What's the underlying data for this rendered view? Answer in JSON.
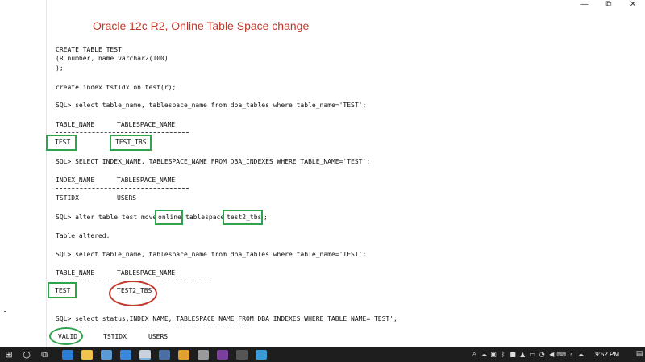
{
  "window": {
    "min_icon": "minimize-icon",
    "max_icon": "restore-icon",
    "close_icon": "close-icon",
    "min_glyph": "—",
    "max_glyph": "⧉",
    "close_glyph": "✕"
  },
  "document": {
    "title": "Oracle 12c R2, Online Table Space change",
    "lines": {
      "create_table": "CREATE TABLE TEST",
      "columns": "(R number, name varchar2(100)",
      "close_paren": ");",
      "create_index": "create index tstidx on test(r);",
      "query1": "SQL> select table_name, tablespace_name from dba_tables where table_name='TEST';",
      "header1_col1": "TABLE_NAME",
      "header1_col2": "TABLESPACE_NAME",
      "row1_col1": "TEST",
      "row1_col2": "TEST_TBS",
      "query2": "SQL> SELECT INDEX_NAME, TABLESPACE_NAME FROM DBA_INDEXES WHERE TABLE_NAME='TEST';",
      "header2_col1": "INDEX_NAME",
      "header2_col2": "TABLESPACE_NAME",
      "row2_col1": "TSTIDX",
      "row2_col2": "USERS",
      "alter_prefix": "SQL> alter table test move",
      "alter_online": "online",
      "alter_mid": "tablespace",
      "alter_tbs": "test2_tbs",
      "alter_end": ";",
      "altered": "Table altered.",
      "query3": "SQL> select table_name, tablespace_name from dba_tables where table_name='TEST';",
      "header3_col1": "TABLE_NAME",
      "header3_col2": "TABLESPACE_NAME",
      "row3_col1": "TEST",
      "row3_col2": "TEST2_TBS",
      "query4": "SQL> select status,INDEX_NAME, TABLESPACE_NAME FROM DBA_INDEXES WHERE TABLE_NAME='TEST';",
      "row4_col1": "VALID",
      "row4_col2": "TSTIDX",
      "row4_col3": "USERS"
    }
  },
  "taskbar": {
    "start_glyph": "⊞",
    "search_glyph": "○",
    "taskview_glyph": "⧉",
    "apps": [
      {
        "name": "edge-icon",
        "color": "#2b7cd3"
      },
      {
        "name": "file-explorer-icon",
        "color": "#f2c14e"
      },
      {
        "name": "store-icon",
        "color": "#5a9bd5"
      },
      {
        "name": "mail-icon",
        "color": "#3a87d8"
      },
      {
        "name": "photos-icon",
        "color": "#c7d2dc"
      },
      {
        "name": "r-app-icon",
        "color": "#4a6fa5"
      },
      {
        "name": "chrome-icon",
        "color": "#e0a030"
      },
      {
        "name": "settings-icon",
        "color": "#9a9a9a"
      },
      {
        "name": "onenote-icon",
        "color": "#7b3fa0"
      },
      {
        "name": "terminal-icon",
        "color": "#555555"
      },
      {
        "name": "snipping-tool-icon",
        "color": "#3c9ad8"
      }
    ],
    "tray": [
      {
        "name": "people-icon",
        "glyph": "♙"
      },
      {
        "name": "onedrive-icon",
        "glyph": "☁"
      },
      {
        "name": "app-tray-icon",
        "glyph": "▣"
      },
      {
        "name": "bluetooth-icon",
        "glyph": "ᛒ"
      },
      {
        "name": "tray-icon-2",
        "glyph": "■"
      },
      {
        "name": "tray-icon-3",
        "glyph": "▲"
      },
      {
        "name": "power-icon",
        "glyph": "▭"
      },
      {
        "name": "network-icon",
        "glyph": "◔"
      },
      {
        "name": "volume-icon",
        "glyph": "◀"
      },
      {
        "name": "keyboard-icon",
        "glyph": "⌨"
      },
      {
        "name": "help-icon",
        "glyph": "?"
      },
      {
        "name": "cloud-icon",
        "glyph": "☁"
      }
    ],
    "clock": "9:52 PM",
    "notification_glyph": "▤"
  }
}
